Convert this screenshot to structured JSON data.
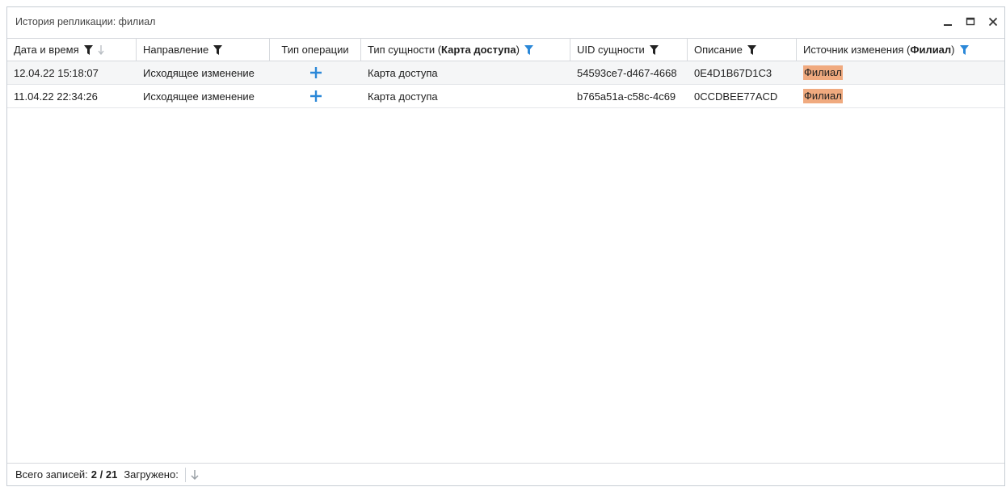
{
  "window": {
    "title": "История репликации: филиал"
  },
  "columns": [
    {
      "label": "Дата и время",
      "filter": true,
      "filter_active": false,
      "sort": "desc"
    },
    {
      "label": "Направление",
      "filter": true,
      "filter_active": false
    },
    {
      "label": "Тип операции",
      "filter": false
    },
    {
      "label_prefix": "Тип сущности (",
      "label_bold": "Карта доступа",
      "label_suffix": " )",
      "filter": true,
      "filter_active": true
    },
    {
      "label": "UID сущности",
      "filter": true,
      "filter_active": false
    },
    {
      "label": "Описание",
      "filter": true,
      "filter_active": false
    },
    {
      "label_prefix": "Источник изменения (",
      "label_bold": "Филиал",
      "label_suffix": " )",
      "filter": true,
      "filter_active": true
    }
  ],
  "rows": [
    {
      "datetime": "12.04.22 15:18:07",
      "direction": "Исходящее изменение",
      "operation_icon": "plus-icon",
      "entity_type": "Карта доступа",
      "uid": "54593ce7-d467-4668",
      "description": "0E4D1B67D1C3",
      "source": "Филиал"
    },
    {
      "datetime": "11.04.22 22:34:26",
      "direction": "Исходящее изменение",
      "operation_icon": "plus-icon",
      "entity_type": "Карта доступа",
      "uid": "b765a51a-c58c-4c69",
      "description": "0CCDBEE77ACD",
      "source": "Филиал"
    }
  ],
  "status": {
    "total_label": "Всего записей:",
    "total_value": "2 / 21",
    "loaded_label": "Загружено:"
  },
  "colors": {
    "accent": "#2b88d8",
    "highlight": "#f0aa7f"
  }
}
